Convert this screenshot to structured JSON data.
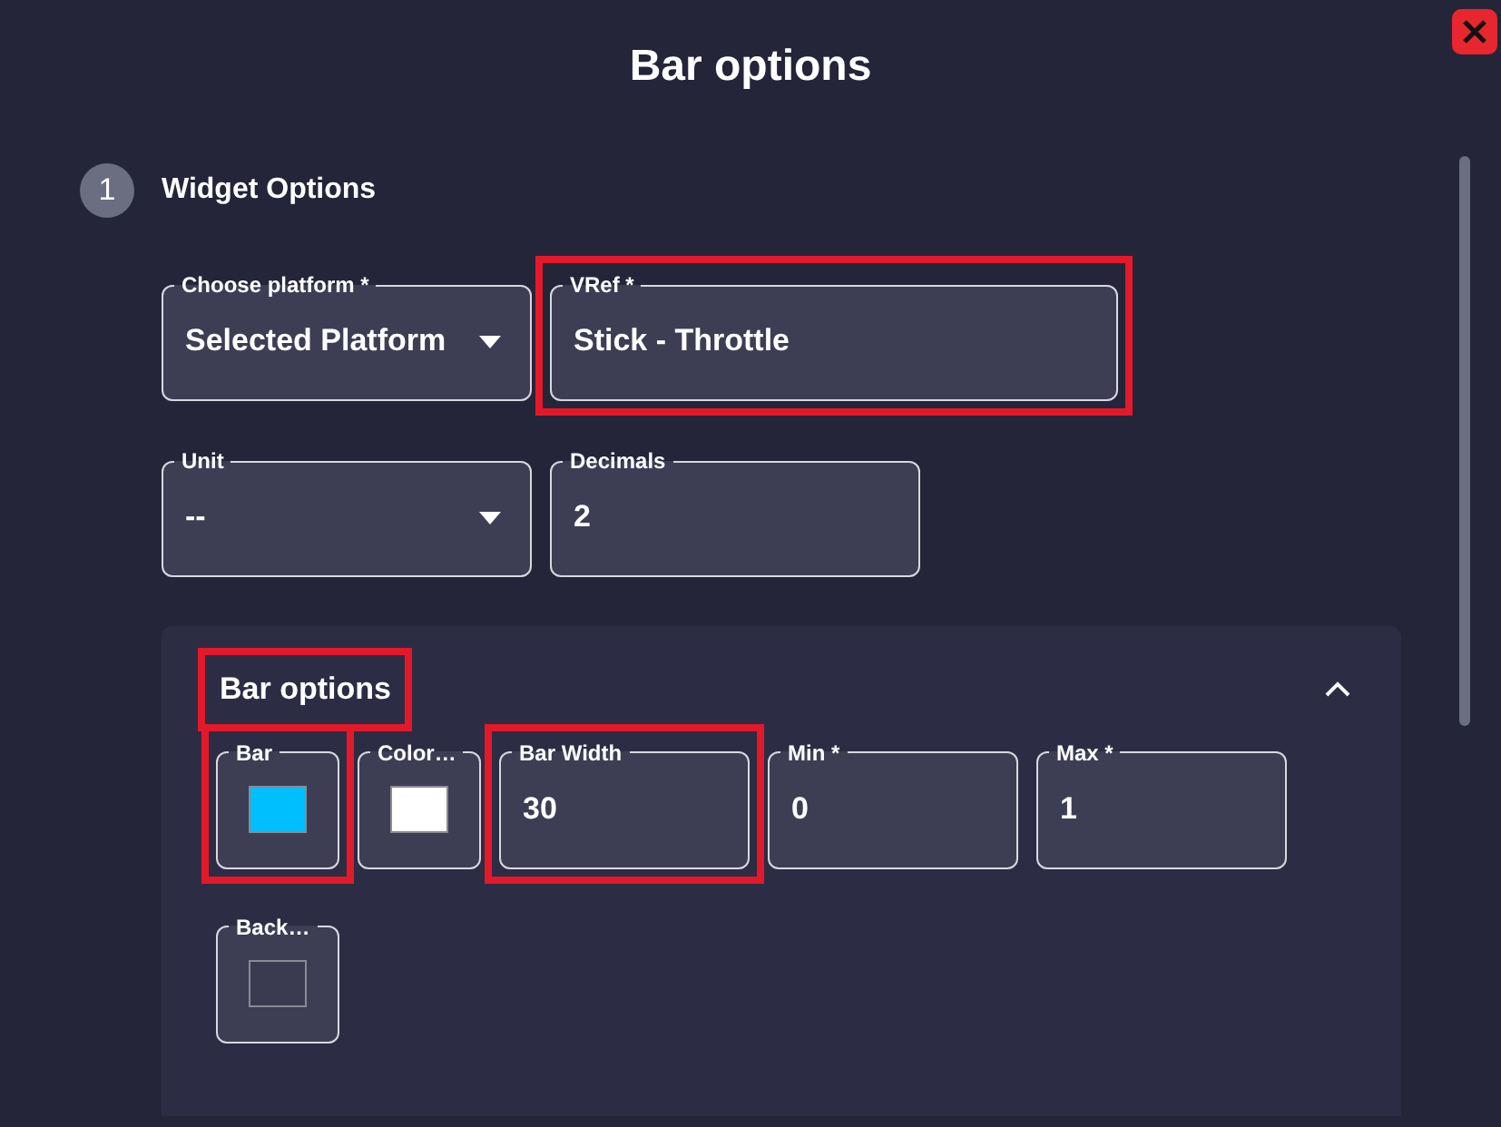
{
  "dialog": {
    "title": "Bar options"
  },
  "step": {
    "number": "1",
    "title": "Widget Options"
  },
  "field_rows": [
    [
      {
        "kind": "select",
        "label": "Choose platform *",
        "value": "Selected Platform",
        "highlighted": false
      },
      {
        "kind": "text",
        "label": "VRef *",
        "value": "Stick - Throttle",
        "highlighted": true
      }
    ],
    [
      {
        "kind": "select",
        "label": "Unit",
        "value": "--",
        "highlighted": false
      },
      {
        "kind": "text",
        "label": "Decimals",
        "value": "2",
        "highlighted": false
      }
    ]
  ],
  "section": {
    "title": "Bar options",
    "highlighted": true,
    "expanded": true,
    "field_rows": [
      [
        {
          "kind": "color",
          "label": "Bar",
          "color": "#00bfff",
          "highlighted": true
        },
        {
          "kind": "color",
          "label": "Color…",
          "color": "#ffffff",
          "highlighted": false
        },
        {
          "kind": "text",
          "label": "Bar Width",
          "value": "30",
          "highlighted": true
        },
        {
          "kind": "text",
          "label": "Min *",
          "value": "0",
          "highlighted": false
        },
        {
          "kind": "text",
          "label": "Max *",
          "value": "1",
          "highlighted": false
        }
      ],
      [
        {
          "kind": "color",
          "label": "Back…",
          "color": "#3a3b50",
          "highlighted": false
        }
      ]
    ]
  }
}
